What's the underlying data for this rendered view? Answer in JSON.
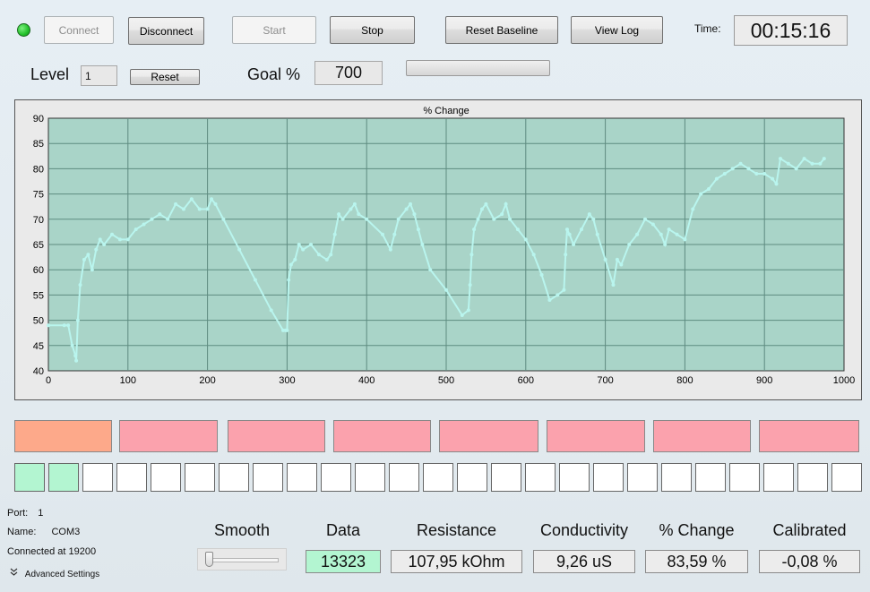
{
  "status": {
    "led_color": "#22c02a"
  },
  "toolbar": {
    "connect_label": "Connect",
    "disconnect_label": "Disconnect",
    "start_label": "Start",
    "stop_label": "Stop",
    "reset_baseline_label": "Reset Baseline",
    "view_log_label": "View Log",
    "time_label": "Time:",
    "time_value": "00:15:16"
  },
  "level": {
    "label": "Level",
    "value": "1",
    "reset_label": "Reset"
  },
  "goal": {
    "label": "Goal %",
    "value": "700",
    "progress": 0
  },
  "chart_data": {
    "type": "scatter",
    "title": "% Change",
    "xlim": [
      0,
      1000
    ],
    "ylim": [
      40,
      90
    ],
    "x_ticks": [
      0,
      100,
      200,
      300,
      400,
      500,
      600,
      700,
      800,
      900,
      1000
    ],
    "y_ticks": [
      40,
      45,
      50,
      55,
      60,
      65,
      70,
      75,
      80,
      85,
      90
    ],
    "grid": true,
    "background": "#a9d4c8",
    "point_color": "#b9f5ee",
    "series": [
      {
        "x": [
          0,
          20,
          25,
          30,
          34,
          35,
          37,
          40,
          45,
          50,
          55,
          60,
          65,
          70,
          80,
          90,
          100,
          110,
          120,
          130,
          140,
          150,
          160,
          170,
          180,
          190,
          200,
          205,
          210,
          220,
          240,
          260,
          280,
          295,
          298,
          300,
          302,
          305,
          310,
          315,
          320,
          330,
          340,
          350,
          355,
          360,
          365,
          370,
          380,
          385,
          390,
          400,
          420,
          430,
          435,
          440,
          450,
          455,
          460,
          465,
          470,
          480,
          500,
          520,
          528,
          530,
          532,
          535,
          540,
          545,
          550,
          560,
          570,
          575,
          580,
          590,
          600,
          610,
          620,
          630,
          640,
          648,
          650,
          652,
          655,
          660,
          670,
          680,
          685,
          690,
          700,
          710,
          715,
          720,
          730,
          740,
          750,
          760,
          770,
          775,
          780,
          790,
          800,
          810,
          820,
          830,
          840,
          850,
          860,
          870,
          880,
          890,
          900,
          910,
          915,
          920,
          930,
          940,
          950,
          960,
          970,
          975
        ],
        "y": [
          49,
          49,
          49,
          45,
          43,
          42,
          50,
          57,
          62,
          63,
          60,
          64,
          66,
          65,
          67,
          66,
          66,
          68,
          69,
          70,
          71,
          70,
          73,
          72,
          74,
          72,
          72,
          74,
          73,
          70,
          64,
          58,
          52,
          48,
          48,
          48,
          58,
          61,
          62,
          65,
          64,
          65,
          63,
          62,
          63,
          67,
          71,
          70,
          72,
          73,
          71,
          70,
          67,
          64,
          67,
          70,
          72,
          73,
          71,
          68,
          65,
          60,
          56,
          51,
          52,
          57,
          63,
          68,
          70,
          72,
          73,
          70,
          71,
          73,
          70,
          68,
          66,
          63,
          59,
          54,
          55,
          56,
          63,
          68,
          67,
          65,
          68,
          71,
          70,
          67,
          62,
          57,
          62,
          61,
          65,
          67,
          70,
          69,
          67,
          65,
          68,
          67,
          66,
          72,
          75,
          76,
          78,
          79,
          80,
          81,
          80,
          79,
          79,
          78,
          77,
          82,
          81,
          80,
          82,
          81,
          81,
          82
        ]
      }
    ]
  },
  "phases": [
    {
      "color": "#fda98a"
    },
    {
      "color": "#fba2ad"
    },
    {
      "color": "#fba2ad"
    },
    {
      "color": "#fba2ad"
    },
    {
      "color": "#fba2ad"
    },
    {
      "color": "#fba2ad"
    },
    {
      "color": "#fba2ad"
    },
    {
      "color": "#fba2ad"
    }
  ],
  "cells": {
    "filled_color": "#b3f5d1",
    "filled_count": 2,
    "total_count": 25
  },
  "connection": {
    "port_label": "Port:",
    "port_value": "1",
    "name_label": "Name:",
    "name_value": "COM3",
    "status": "Connected at 19200",
    "advanced_label": "Advanced Settings"
  },
  "readouts": {
    "smooth_label": "Smooth",
    "smooth_level": 0,
    "data_label": "Data",
    "data_value": "13323",
    "data_color": "#b3f5d1",
    "resistance_label": "Resistance",
    "resistance_value": "107,95 kOhm",
    "conductivity_label": "Conductivity",
    "conductivity_value": "9,26 uS",
    "change_label": "% Change",
    "change_value": "83,59 %",
    "calibrated_label": "Calibrated",
    "calibrated_value": "-0,08 %"
  }
}
